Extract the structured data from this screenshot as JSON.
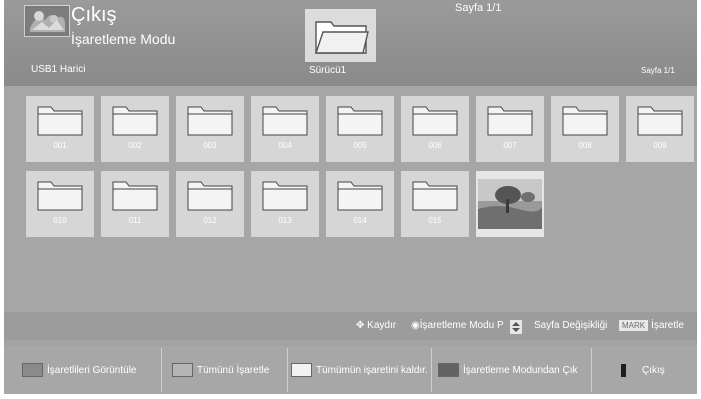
{
  "header": {
    "title": "Çıkış",
    "mode": "İşaretleme Modu",
    "device": "USB1 Harici",
    "drive": "Sürücü1",
    "page_top": "Sayfa 1/1",
    "page_right": "Sayfa 1/1",
    "exit_icon": "exit-icon",
    "folder_icon": "folder-open-icon"
  },
  "grid": {
    "items": [
      {
        "label": "001",
        "type": "folder"
      },
      {
        "label": "002",
        "type": "folder"
      },
      {
        "label": "003",
        "type": "folder"
      },
      {
        "label": "004",
        "type": "folder"
      },
      {
        "label": "005",
        "type": "folder"
      },
      {
        "label": "006",
        "type": "folder"
      },
      {
        "label": "007",
        "type": "folder"
      },
      {
        "label": "008",
        "type": "folder"
      },
      {
        "label": "009",
        "type": "folder"
      },
      {
        "label": "010",
        "type": "folder"
      },
      {
        "label": "011",
        "type": "folder"
      },
      {
        "label": "012",
        "type": "folder"
      },
      {
        "label": "013",
        "type": "folder"
      },
      {
        "label": "014",
        "type": "folder"
      },
      {
        "label": "015",
        "type": "folder"
      },
      {
        "label": "",
        "type": "photo"
      }
    ]
  },
  "hints": {
    "scroll": "Kaydır",
    "mark_mode": "İşaretleme Modu P",
    "page_change": "Sayfa Değişikliği",
    "mark_key": "MARK",
    "mark": "İşaretle"
  },
  "buttons": [
    {
      "label": "İşaretlileri Görüntüle",
      "color": "#8a8a8a"
    },
    {
      "label": "Tümünü İşaretle",
      "color": "#b5b5b5"
    },
    {
      "label": "Tümümün işaretini kaldır.",
      "color": "#f2f2f2"
    },
    {
      "label": "İşaretleme Modundan Çık",
      "color": "#626262"
    },
    {
      "label": "Çıkış",
      "color": "#1e1e1e"
    }
  ],
  "colors": {
    "background": "#a3a3a3",
    "tile": "#d6d6d6",
    "text": "#ffffff"
  }
}
